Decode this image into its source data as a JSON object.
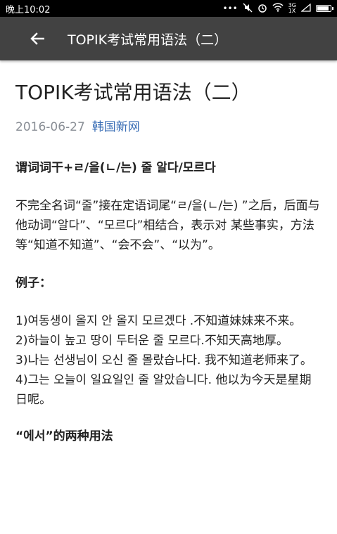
{
  "status": {
    "time": "晚上10:02",
    "network": [
      "3G",
      "1X"
    ]
  },
  "appbar": {
    "title": "TOPIK考试常用语法（二）"
  },
  "article": {
    "title": "TOPIK考试常用语法（二）",
    "date": "2016-06-27",
    "source": "韩国新网",
    "heading1": "谓词词干+ㄹ/을(ㄴ/는) 줄 알다/모르다",
    "paragraph1": "不完全名词“줄”接在定语词尾“ㄹ/을(ㄴ/는) ”之后，后面与他动词“알다”、“모르다”相结合，表示对 某些事实，方法等“知道不知道”、“会不会”、“以为”。",
    "examples_label": "例子：",
    "examples": [
      "1)여동생이 올지 안 올지 모르겠다 .不知道妹妹来不来。",
      "2)하늘이 높고 땅이 두터운 줄 모르다.不知天高地厚。",
      "3)나는 선생님이 오신 줄 몰랐습나다. 我不知道老师来了。",
      "4)그는 오늘이 일요일인 줄 알았습니다. 他以为今天是星期日呢。"
    ],
    "heading2": "“에서”的两种用法"
  }
}
